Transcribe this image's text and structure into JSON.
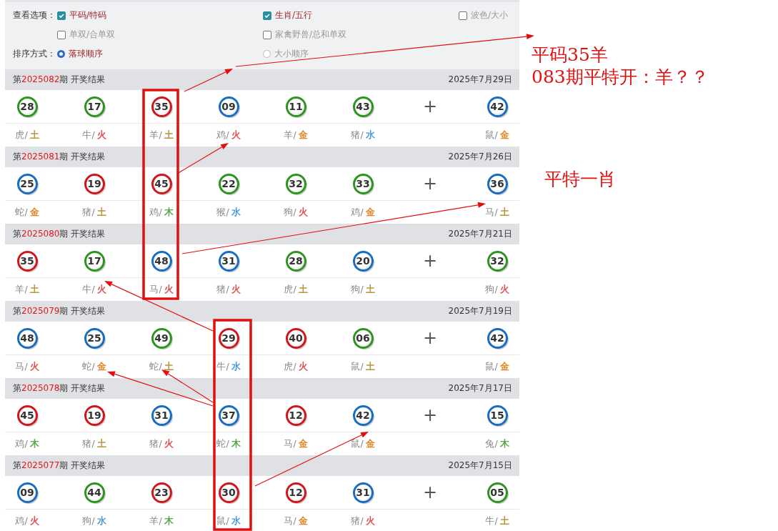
{
  "options": {
    "label": "查看选项：",
    "items": [
      {
        "label": "平码/特码",
        "checked": true
      },
      {
        "label": "生肖/五行",
        "checked": true
      },
      {
        "label": "波色/大小",
        "checked": false
      },
      {
        "label": "单双/合单双",
        "checked": false
      },
      {
        "label": "家禽野兽/总和单双",
        "checked": false
      }
    ]
  },
  "sort": {
    "label": "排序方式：",
    "items": [
      {
        "label": "落球顺序",
        "selected": true
      },
      {
        "label": "大小顺序",
        "selected": false
      }
    ]
  },
  "draws": [
    {
      "title_prefix": "第",
      "period": "2025082",
      "title_suffix": "期 开奖结果",
      "date": "2025年7月29日",
      "plus": "+",
      "balls": [
        {
          "number": "28",
          "color": "#2e9420",
          "zodiac": "虎/",
          "element": {
            "label": "土",
            "color": "#b8963c"
          }
        },
        {
          "number": "17",
          "color": "#2e9420",
          "zodiac": "牛/",
          "element": {
            "label": "火",
            "color": "#e05050"
          }
        },
        {
          "number": "35",
          "color": "#d0161b",
          "zodiac": "羊/",
          "element": {
            "label": "土",
            "color": "#b8963c"
          }
        },
        {
          "number": "09",
          "color": "#1a6cc0",
          "zodiac": "鸡/",
          "element": {
            "label": "火",
            "color": "#e05050"
          }
        },
        {
          "number": "11",
          "color": "#2e9420",
          "zodiac": "羊/",
          "element": {
            "label": "金",
            "color": "#e08a2a"
          }
        },
        {
          "number": "43",
          "color": "#2e9420",
          "zodiac": "猪/",
          "element": {
            "label": "水",
            "color": "#4a9ad8"
          }
        },
        {
          "number": "42",
          "color": "#1a6cc0",
          "zodiac": "鼠/",
          "element": {
            "label": "金",
            "color": "#e08a2a"
          }
        }
      ]
    },
    {
      "title_prefix": "第",
      "period": "2025081",
      "title_suffix": "期 开奖结果",
      "date": "2025年7月26日",
      "plus": "+",
      "balls": [
        {
          "number": "25",
          "color": "#1a6cc0",
          "zodiac": "蛇/",
          "element": {
            "label": "金",
            "color": "#e08a2a"
          }
        },
        {
          "number": "19",
          "color": "#d0161b",
          "zodiac": "猪/",
          "element": {
            "label": "土",
            "color": "#b8963c"
          }
        },
        {
          "number": "45",
          "color": "#d0161b",
          "zodiac": "鸡/",
          "element": {
            "label": "木",
            "color": "#5aaa4a"
          }
        },
        {
          "number": "22",
          "color": "#2e9420",
          "zodiac": "猴/",
          "element": {
            "label": "水",
            "color": "#4a9ad8"
          }
        },
        {
          "number": "32",
          "color": "#2e9420",
          "zodiac": "狗/",
          "element": {
            "label": "火",
            "color": "#e05050"
          }
        },
        {
          "number": "33",
          "color": "#2e9420",
          "zodiac": "鸡/",
          "element": {
            "label": "金",
            "color": "#e08a2a"
          }
        },
        {
          "number": "36",
          "color": "#1a6cc0",
          "zodiac": "马/",
          "element": {
            "label": "土",
            "color": "#b8963c"
          }
        }
      ]
    },
    {
      "title_prefix": "第",
      "period": "2025080",
      "title_suffix": "期 开奖结果",
      "date": "2025年7月21日",
      "plus": "+",
      "balls": [
        {
          "number": "35",
          "color": "#d0161b",
          "zodiac": "羊/",
          "element": {
            "label": "土",
            "color": "#b8963c"
          }
        },
        {
          "number": "17",
          "color": "#2e9420",
          "zodiac": "牛/",
          "element": {
            "label": "火",
            "color": "#e05050"
          }
        },
        {
          "number": "48",
          "color": "#1a6cc0",
          "zodiac": "马/",
          "element": {
            "label": "火",
            "color": "#e05050"
          }
        },
        {
          "number": "31",
          "color": "#1a6cc0",
          "zodiac": "猪/",
          "element": {
            "label": "火",
            "color": "#e05050"
          }
        },
        {
          "number": "28",
          "color": "#2e9420",
          "zodiac": "虎/",
          "element": {
            "label": "土",
            "color": "#b8963c"
          }
        },
        {
          "number": "20",
          "color": "#1a6cc0",
          "zodiac": "狗/",
          "element": {
            "label": "土",
            "color": "#b8963c"
          }
        },
        {
          "number": "32",
          "color": "#2e9420",
          "zodiac": "狗/",
          "element": {
            "label": "火",
            "color": "#e05050"
          }
        }
      ]
    },
    {
      "title_prefix": "第",
      "period": "2025079",
      "title_suffix": "期 开奖结果",
      "date": "2025年7月19日",
      "plus": "+",
      "balls": [
        {
          "number": "48",
          "color": "#1a6cc0",
          "zodiac": "马/",
          "element": {
            "label": "火",
            "color": "#e05050"
          }
        },
        {
          "number": "25",
          "color": "#1a6cc0",
          "zodiac": "蛇/",
          "element": {
            "label": "金",
            "color": "#e08a2a"
          }
        },
        {
          "number": "49",
          "color": "#2e9420",
          "zodiac": "蛇/",
          "element": {
            "label": "土",
            "color": "#b8963c"
          }
        },
        {
          "number": "29",
          "color": "#d0161b",
          "zodiac": "牛/",
          "element": {
            "label": "水",
            "color": "#4a9ad8"
          }
        },
        {
          "number": "40",
          "color": "#d0161b",
          "zodiac": "虎/",
          "element": {
            "label": "火",
            "color": "#e05050"
          }
        },
        {
          "number": "06",
          "color": "#2e9420",
          "zodiac": "鼠/",
          "element": {
            "label": "土",
            "color": "#b8963c"
          }
        },
        {
          "number": "42",
          "color": "#1a6cc0",
          "zodiac": "鼠/",
          "element": {
            "label": "金",
            "color": "#e08a2a"
          }
        }
      ]
    },
    {
      "title_prefix": "第",
      "period": "2025078",
      "title_suffix": "期 开奖结果",
      "date": "2025年7月17日",
      "plus": "+",
      "balls": [
        {
          "number": "45",
          "color": "#d0161b",
          "zodiac": "鸡/",
          "element": {
            "label": "木",
            "color": "#5aaa4a"
          }
        },
        {
          "number": "19",
          "color": "#d0161b",
          "zodiac": "猪/",
          "element": {
            "label": "土",
            "color": "#b8963c"
          }
        },
        {
          "number": "31",
          "color": "#1a6cc0",
          "zodiac": "猪/",
          "element": {
            "label": "火",
            "color": "#e05050"
          }
        },
        {
          "number": "37",
          "color": "#1a6cc0",
          "zodiac": "蛇/",
          "element": {
            "label": "木",
            "color": "#5aaa4a"
          }
        },
        {
          "number": "12",
          "color": "#d0161b",
          "zodiac": "马/",
          "element": {
            "label": "金",
            "color": "#e08a2a"
          }
        },
        {
          "number": "42",
          "color": "#1a6cc0",
          "zodiac": "鼠/",
          "element": {
            "label": "金",
            "color": "#e08a2a"
          }
        },
        {
          "number": "15",
          "color": "#1a6cc0",
          "zodiac": "兔/",
          "element": {
            "label": "木",
            "color": "#5aaa4a"
          }
        }
      ]
    },
    {
      "title_prefix": "第",
      "period": "2025077",
      "title_suffix": "期 开奖结果",
      "date": "2025年7月15日",
      "plus": "+",
      "balls": [
        {
          "number": "09",
          "color": "#1a6cc0",
          "zodiac": "鸡/",
          "element": {
            "label": "火",
            "color": "#e05050"
          }
        },
        {
          "number": "44",
          "color": "#2e9420",
          "zodiac": "狗/",
          "element": {
            "label": "水",
            "color": "#4a9ad8"
          }
        },
        {
          "number": "23",
          "color": "#d0161b",
          "zodiac": "羊/",
          "element": {
            "label": "木",
            "color": "#5aaa4a"
          }
        },
        {
          "number": "30",
          "color": "#d0161b",
          "zodiac": "鼠/",
          "element": {
            "label": "水",
            "color": "#4a9ad8"
          }
        },
        {
          "number": "12",
          "color": "#d0161b",
          "zodiac": "马/",
          "element": {
            "label": "金",
            "color": "#e08a2a"
          }
        },
        {
          "number": "31",
          "color": "#1a6cc0",
          "zodiac": "猪/",
          "element": {
            "label": "火",
            "color": "#e05050"
          }
        },
        {
          "number": "05",
          "color": "#2e9420",
          "zodiac": "牛/",
          "element": {
            "label": "土",
            "color": "#b8963c"
          }
        }
      ]
    }
  ],
  "annotations": {
    "notes": [
      "平码35羊",
      "083期平特开：羊？？",
      "平特一肖"
    ]
  }
}
